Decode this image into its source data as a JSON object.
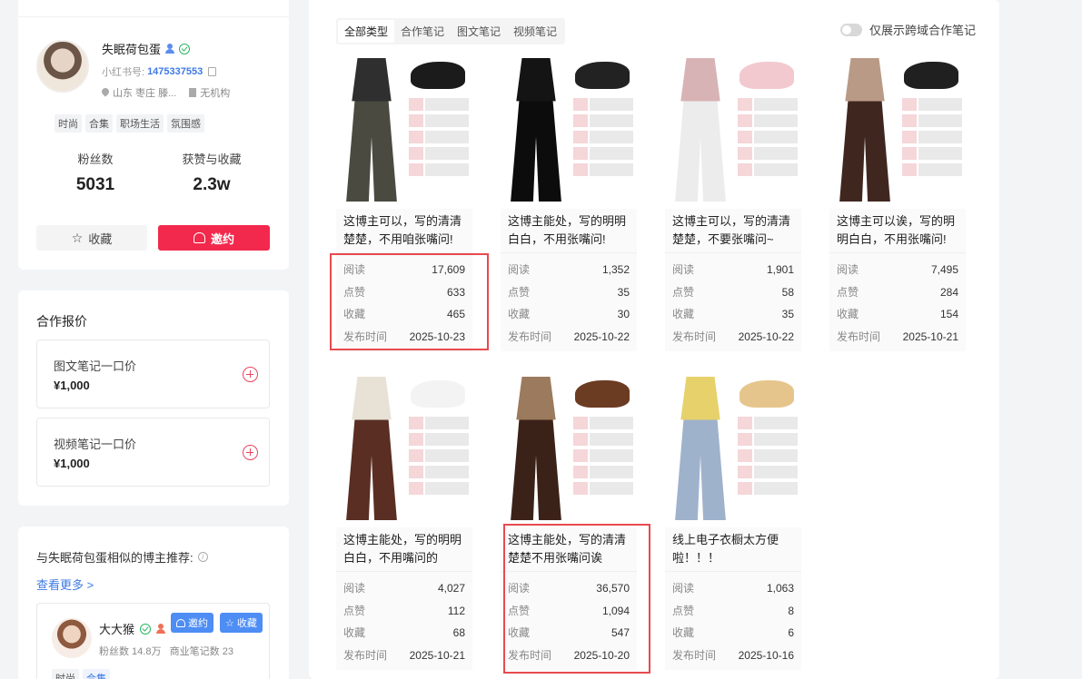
{
  "profile": {
    "name": "失眠荷包蛋",
    "redbook_label": "小红书号:",
    "redbook_id": "1475337553",
    "location": "山东 枣庄 滕...",
    "org": "无机构",
    "tags": [
      "时尚",
      "合集",
      "职场生活",
      "氛围感"
    ],
    "followers_label": "粉丝数",
    "followers": "5031",
    "likes_label": "获赞与收藏",
    "likes": "2.3w",
    "fav_button": "收藏",
    "invite_button": "邀约"
  },
  "pricing": {
    "title": "合作报价",
    "items": [
      {
        "label": "图文笔记一口价",
        "price": "¥1,000"
      },
      {
        "label": "视频笔记一口价",
        "price": "¥1,000"
      }
    ]
  },
  "similar": {
    "title": "与失眠荷包蛋相似的博主推荐:",
    "more": "查看更多 >",
    "blogger": {
      "name": "大大猴",
      "followers": "粉丝数 14.8万",
      "notes": "商业笔记数 23",
      "invite": "邀约",
      "fav": "收藏",
      "tags": [
        "时尚",
        "合集"
      ]
    }
  },
  "filter": {
    "tabs": [
      "全部类型",
      "合作笔记",
      "图文笔记",
      "视频笔记"
    ],
    "toggle_label": "仅展示跨域合作笔记"
  },
  "stat_labels": {
    "read": "阅读",
    "like": "点赞",
    "fav": "收藏",
    "date": "发布时间"
  },
  "notes": [
    {
      "title": "这博主可以，写的清清楚楚，不用咱张嘴问!",
      "read": "17,609",
      "like": "633",
      "fav": "465",
      "date": "2025-10-23"
    },
    {
      "title": "这博主能处，写的明明白白，不用张嘴问!",
      "read": "1,352",
      "like": "35",
      "fav": "30",
      "date": "2025-10-22"
    },
    {
      "title": "这博主可以，写的清清楚楚，不要张嘴问~",
      "read": "1,901",
      "like": "58",
      "fav": "35",
      "date": "2025-10-22"
    },
    {
      "title": "这博主可以诶，写的明明白白，不用张嘴问!",
      "read": "7,495",
      "like": "284",
      "fav": "154",
      "date": "2025-10-21"
    },
    {
      "title": "这博主能处，写的明明白白，不用嘴问的",
      "read": "4,027",
      "like": "112",
      "fav": "68",
      "date": "2025-10-21"
    },
    {
      "title": "这博主能处，写的清清楚楚不用张嘴问诶",
      "read": "36,570",
      "like": "1,094",
      "fav": "547",
      "date": "2025-10-20"
    },
    {
      "title": "线上电子衣橱太方便啦！！！",
      "read": "1,063",
      "like": "8",
      "fav": "6",
      "date": "2025-10-16"
    }
  ],
  "colors": {
    "accent": "#f2294c",
    "link": "#3d7ae5",
    "highlight": "#e84a4f"
  }
}
